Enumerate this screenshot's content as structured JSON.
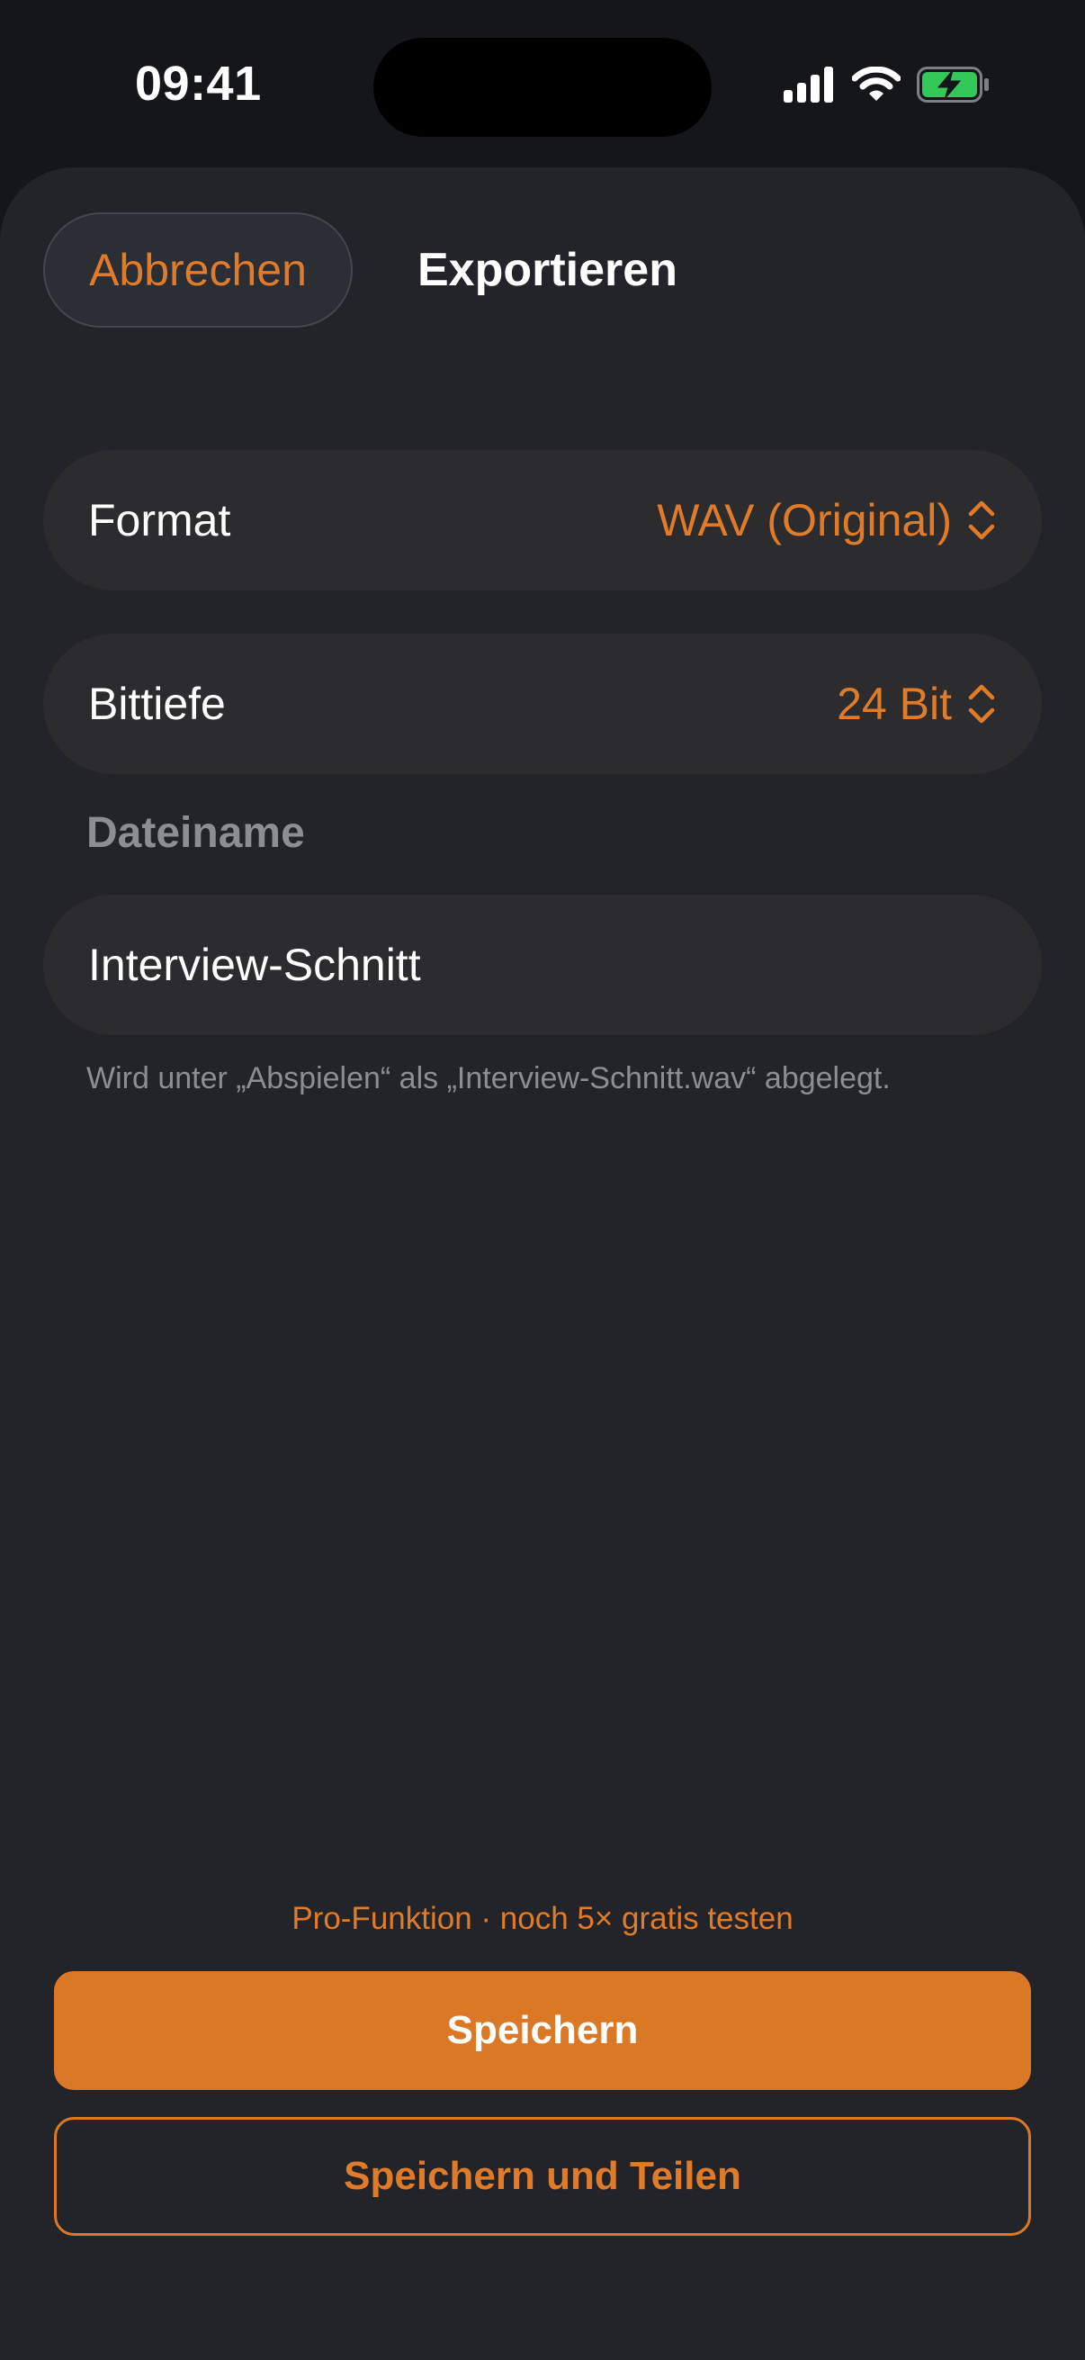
{
  "status_bar": {
    "time": "09:41",
    "icons": [
      "cellular-signal-icon",
      "wifi-icon",
      "battery-charging-icon"
    ]
  },
  "header": {
    "cancel_label": "Abbrechen",
    "title": "Exportieren"
  },
  "settings": {
    "format": {
      "label": "Format",
      "value": "WAV (Original)"
    },
    "bit_depth": {
      "label": "Bittiefe",
      "value": "24 Bit"
    }
  },
  "filename": {
    "section_label": "Dateiname",
    "value": "Interview-Schnitt",
    "hint": "Wird unter „Abspielen“ als „Interview-Schnitt.wav“ abgelegt."
  },
  "footer": {
    "pro_note": "Pro-Funktion · noch 5× gratis testen",
    "save_label": "Speichern",
    "save_share_label": "Speichern und Teilen"
  },
  "colors": {
    "accent": "#db7826",
    "sheet_background": "#232429",
    "row_background": "#2c2c2f",
    "battery_fill": "#34c759"
  }
}
